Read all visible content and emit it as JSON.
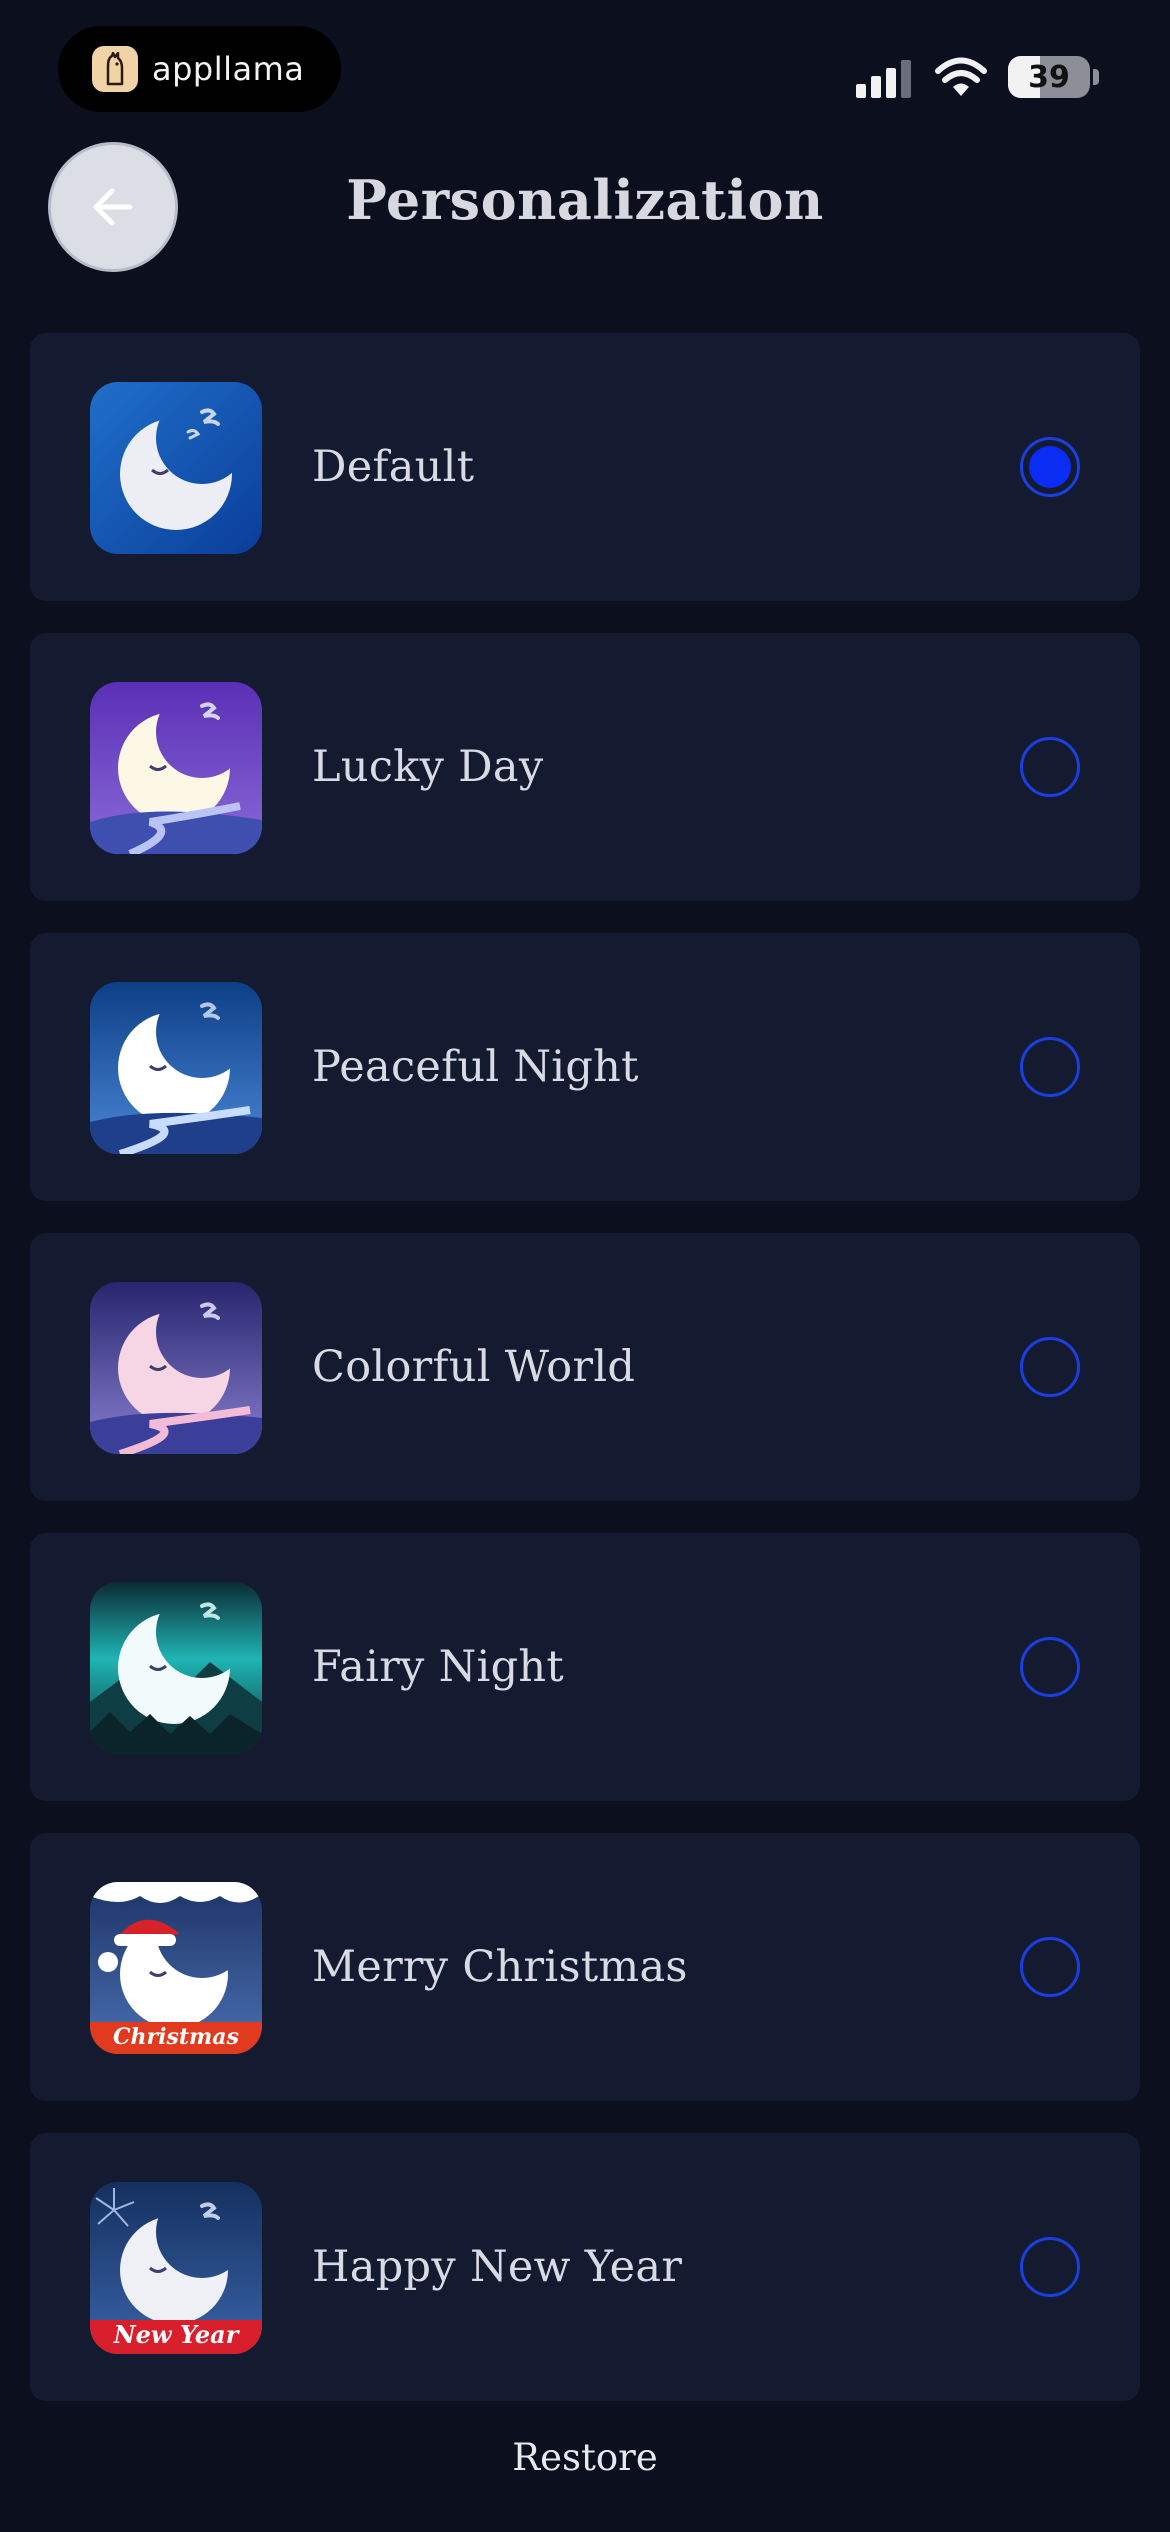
{
  "status_bar": {
    "brand_name": "appllama",
    "battery_level": "39",
    "battery_fraction": 0.39
  },
  "header": {
    "title": "Personalization",
    "back_icon": "arrow-left-icon"
  },
  "themes": [
    {
      "label": "Default",
      "selected": true,
      "icon": "moon-default-icon"
    },
    {
      "label": "Lucky Day",
      "selected": false,
      "icon": "moon-lucky-day-icon"
    },
    {
      "label": "Peaceful Night",
      "selected": false,
      "icon": "moon-peaceful-night-icon"
    },
    {
      "label": "Colorful World",
      "selected": false,
      "icon": "moon-colorful-world-icon"
    },
    {
      "label": "Fairy Night",
      "selected": false,
      "icon": "moon-fairy-night-icon"
    },
    {
      "label": "Merry Christmas",
      "selected": false,
      "icon": "moon-christmas-icon",
      "banner": "Christmas"
    },
    {
      "label": "Happy New Year",
      "selected": false,
      "icon": "moon-new-year-icon",
      "banner": "New Year"
    }
  ],
  "footer": {
    "restore_label": "Restore"
  },
  "colors": {
    "background": "#0b0f1e",
    "card": "#141a30",
    "accent": "#0b2cf2"
  }
}
